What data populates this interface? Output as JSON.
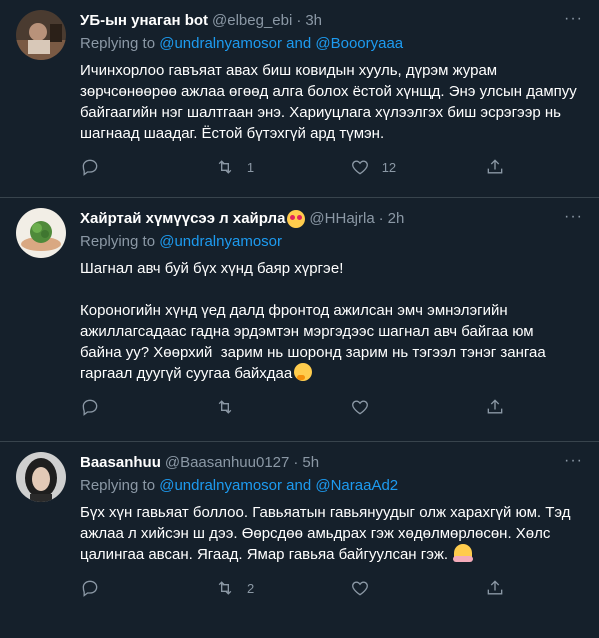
{
  "tweets": [
    {
      "name": "УБ-ын унаган bot",
      "handle": "@elbeg_ebi",
      "dot": "·",
      "time": "3h",
      "replying_prefix": "Replying to ",
      "replying_mentions": "@undralnyamosor and @Boooryaaa",
      "text": "Ичинхорлоо гавъяат авах биш ковидын хууль, дүрэм журам зөрчсөнөөрөө ажлаа өгөөд алга болох ёстой хүнщд. Энэ улсын дампуу байгаагийн нэг шалтгаан энэ. Хариуцлага хүлээлгэх биш эсрэгээр нь шагнаад шаадаг. Ёстой бүтэхгүй ард түмэн.",
      "reply_count": "",
      "retweet_count": "1",
      "like_count": "12"
    },
    {
      "name": "Хайртай хүмүүсээ л хайрла",
      "name_emoji": "smiling-face-with-heart-eyes",
      "handle": "@HHajrla",
      "dot": "·",
      "time": "2h",
      "replying_prefix": "Replying to ",
      "replying_mentions": "@undralnyamosor",
      "text": "Шагнал авч буй бүх хүнд баяр хүргэе!\n\nКороногийн хүнд үед далд фронтод ажилсан эмч эмнэлэгийн ажиллагсадаас гадна эрдэмтэн мэргэдээс шагнал авч байгаа юм байна уу? Хөөрхий  зарим нь шоронд зарим нь тэгээл тэнэг зангаа гаргаал дуугүй суугаа байхдаа",
      "text_emoji": "thinking-face",
      "reply_count": "",
      "retweet_count": "",
      "like_count": ""
    },
    {
      "name": "Baasanhuu",
      "handle": "@Baasanhuu0127",
      "dot": "·",
      "time": "5h",
      "replying_prefix": "Replying to ",
      "replying_mentions": "@undralnyamosor and @NaraaAd2",
      "text": "Бүх хүн гавьяат боллоо. Гавьяатын гавьянуудыг олж харахгүй юм. Тэд ажлаа л хийсэн ш дээ. Өөрсдөө амьдрах гэж хөдөлмөрлөсөн. Хөлс цалингаа авсан. Ягаад. Ямар гавьяа байгуулсан гэж. ",
      "text_emoji": "person-shrugging",
      "reply_count": "",
      "retweet_count": "2",
      "like_count": ""
    }
  ],
  "more_label": "···",
  "colors": {
    "background": "#15202b",
    "divider": "#38444d",
    "secondary_text": "#8b98a5",
    "mention": "#1d9bf0"
  }
}
